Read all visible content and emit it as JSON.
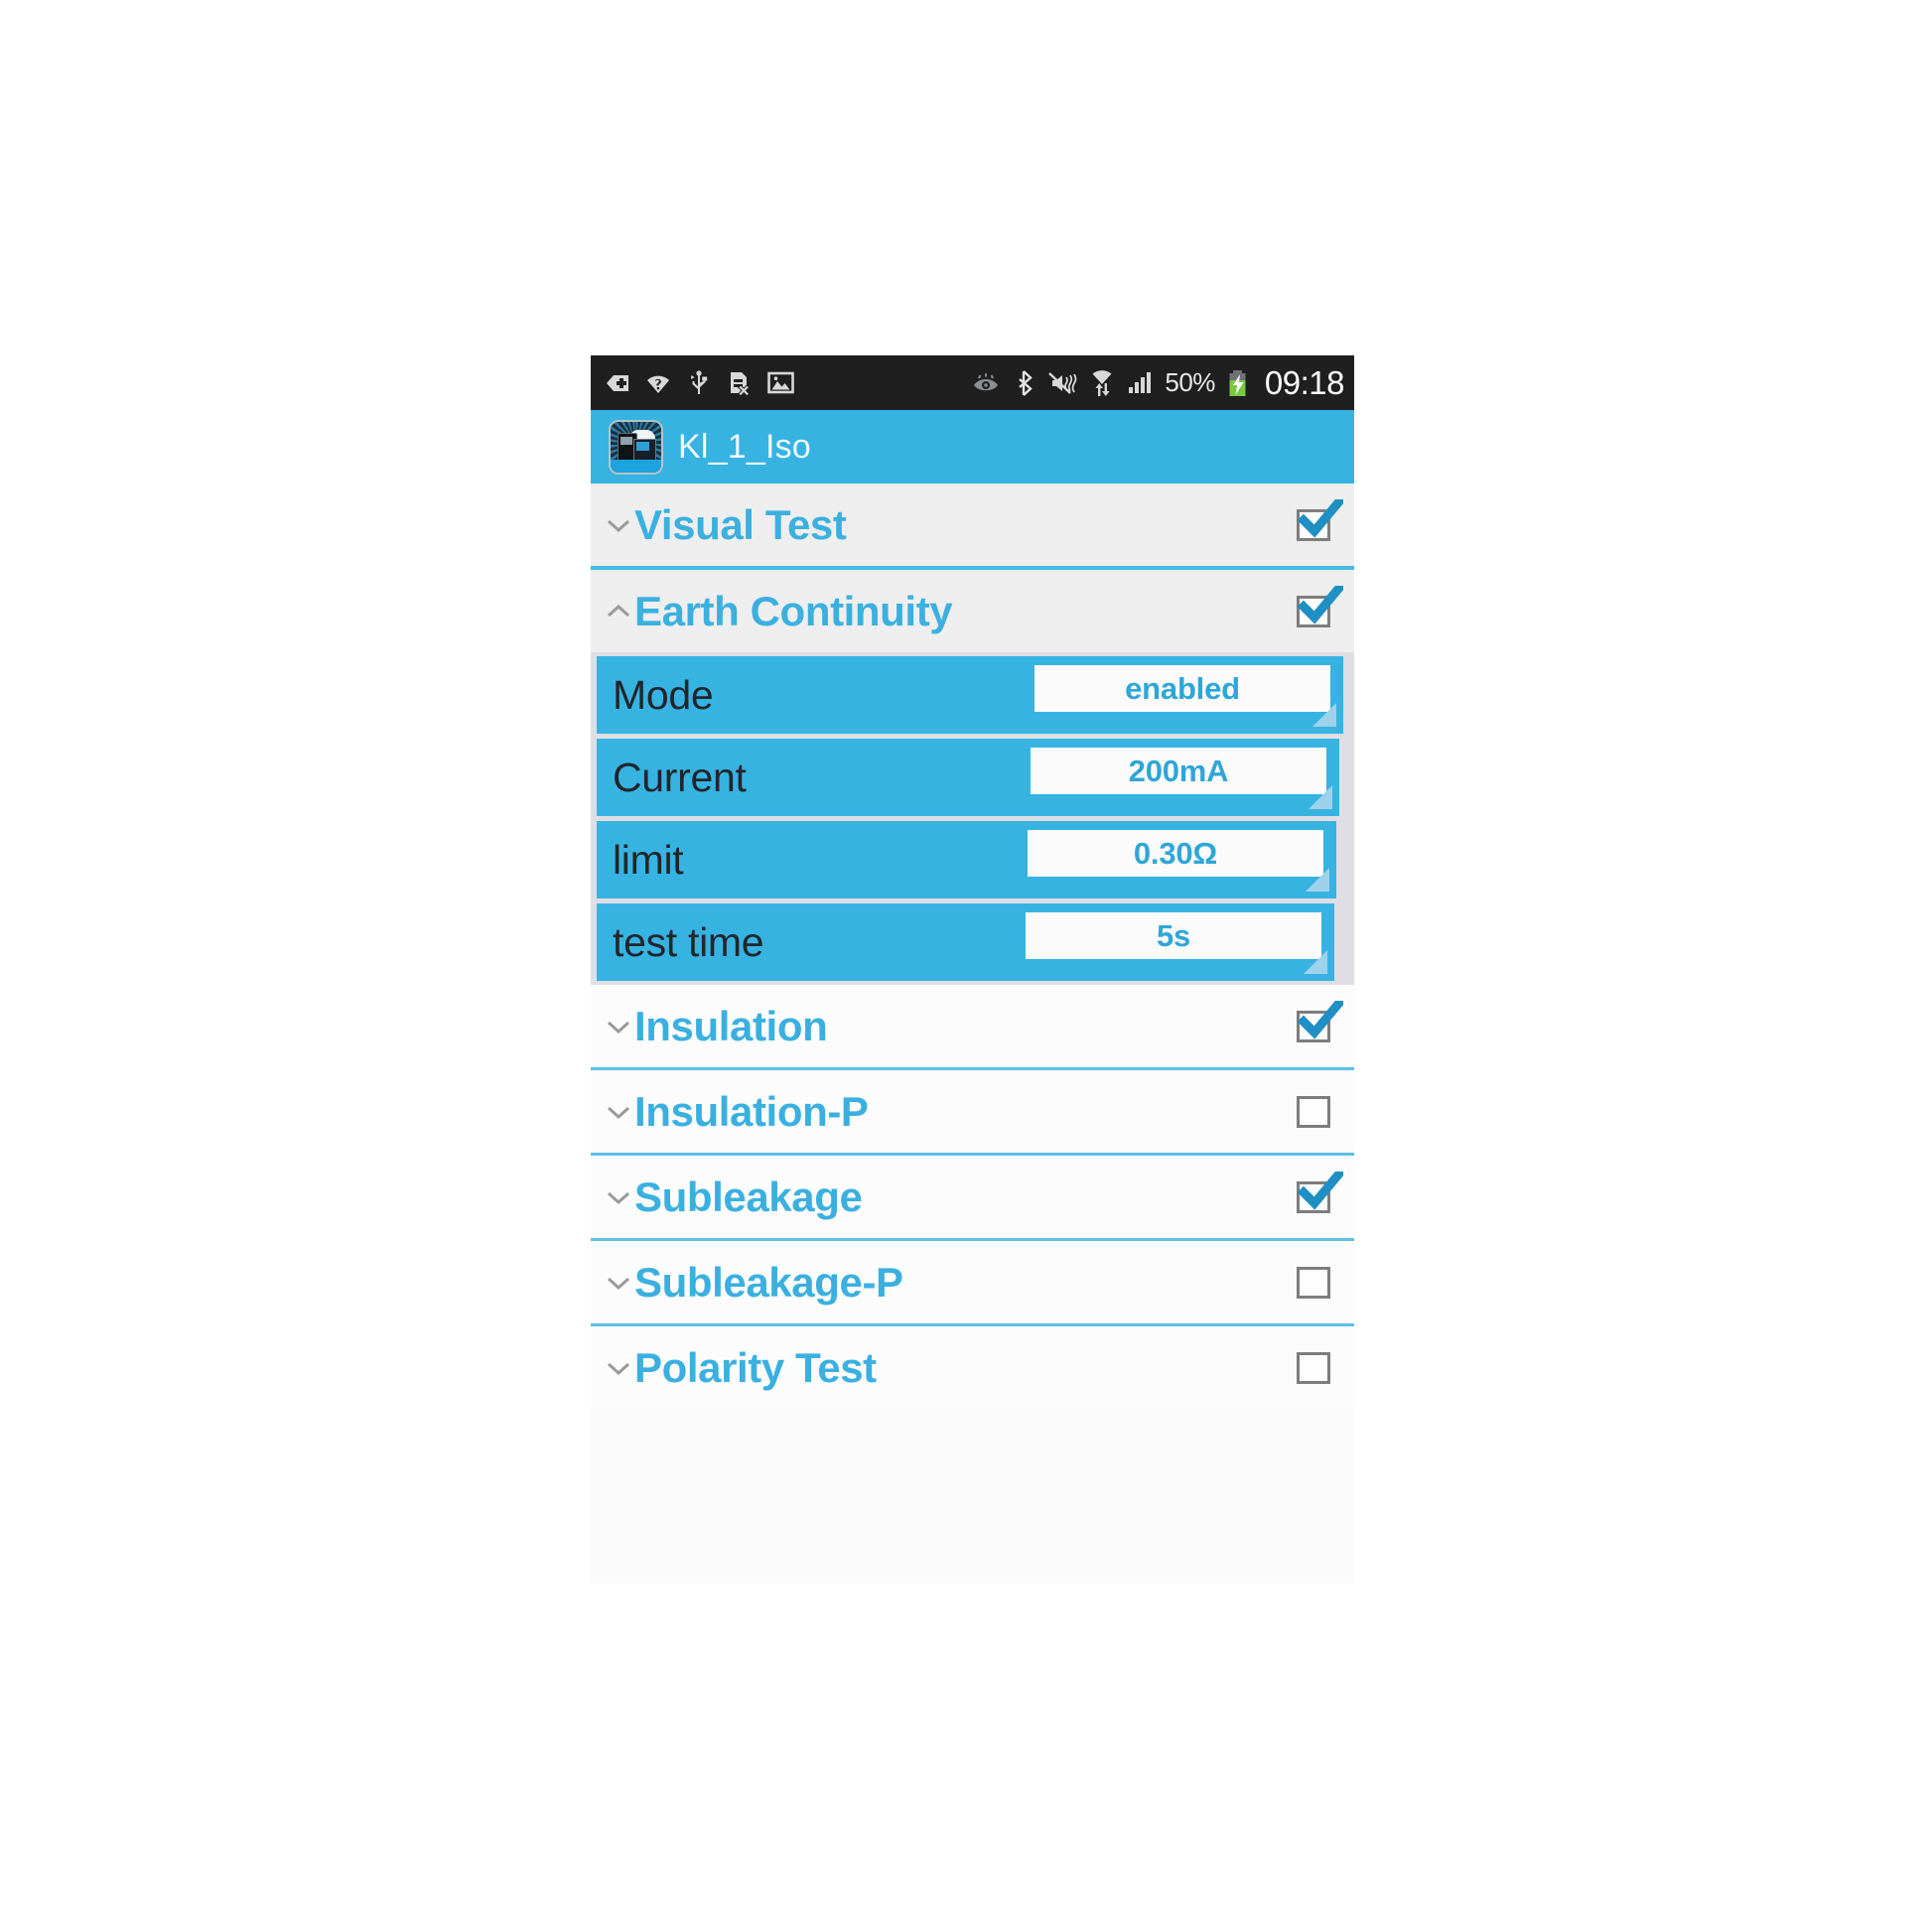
{
  "status_bar": {
    "icons_left": [
      "back-plus-icon",
      "wifi-question-icon",
      "usb-icon",
      "sim-error-icon",
      "image-icon"
    ],
    "icons_right": [
      "eye-smart-stay-icon",
      "bluetooth-icon",
      "sound-mute-vibrate-icon",
      "wifi-transfer-icon",
      "signal-bars-icon"
    ],
    "battery_percent": "50%",
    "battery_icon": "battery-charging-icon",
    "clock": "09:18"
  },
  "app_bar": {
    "icon": "app-launcher-icon",
    "title": "Kl_1_Iso"
  },
  "colors": {
    "accent": "#37b3e2",
    "label_blue": "#3bb0e0",
    "value_blue": "#2fa6d8",
    "divider": "#4bb8e4",
    "section_bg": "#eeeeee",
    "group_frame": "#dedee4"
  },
  "sections": [
    {
      "label": "Visual Test",
      "expanded": false,
      "checked": true,
      "chevron": "chevron-down-icon",
      "highlight": true
    },
    {
      "label": "Earth Continuity",
      "expanded": true,
      "checked": true,
      "chevron": "chevron-up-icon",
      "highlight": true
    },
    {
      "label": "Insulation",
      "expanded": false,
      "checked": true,
      "chevron": "chevron-down-icon",
      "highlight": false
    },
    {
      "label": "Insulation-P",
      "expanded": false,
      "checked": false,
      "chevron": "chevron-down-icon",
      "highlight": false
    },
    {
      "label": "Subleakage",
      "expanded": false,
      "checked": true,
      "chevron": "chevron-down-icon",
      "highlight": false
    },
    {
      "label": "Subleakage-P",
      "expanded": false,
      "checked": false,
      "chevron": "chevron-down-icon",
      "highlight": false
    },
    {
      "label": "Polarity Test",
      "expanded": false,
      "checked": false,
      "chevron": "chevron-down-icon",
      "highlight": false
    }
  ],
  "earth_continuity_settings": [
    {
      "label": "Mode",
      "value": "enabled"
    },
    {
      "label": "Current",
      "value": "200mA"
    },
    {
      "label": "limit",
      "value": "0.30Ω"
    },
    {
      "label": "test time",
      "value": "5s"
    }
  ]
}
